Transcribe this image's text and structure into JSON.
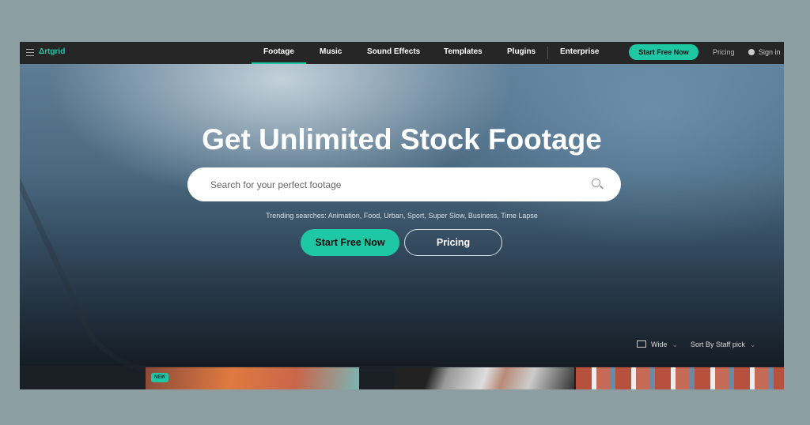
{
  "nav": {
    "logo": "Δrtgrid",
    "items": [
      "Footage",
      "Music",
      "Sound Effects",
      "Templates",
      "Plugins",
      "Enterprise"
    ],
    "active": "Footage",
    "cta": "Start Free Now",
    "pricing": "Pricing",
    "signin": "Sign in"
  },
  "hero": {
    "title": "Get Unlimited Stock Footage",
    "search_placeholder": "Search for your perfect footage",
    "trending": "Trending searches: Animation, Food, Urban, Sport, Super Slow, Business, Time Lapse",
    "cta": "Start Free Now",
    "pricing": "Pricing"
  },
  "controls": {
    "view": "Wide",
    "sort": "Sort By Staff pick"
  },
  "thumbs": {
    "badge": "NEW"
  },
  "colors": {
    "accent": "#1ec8a5",
    "nav_bg": "#262626",
    "page_bg": "#8d9ea3"
  }
}
